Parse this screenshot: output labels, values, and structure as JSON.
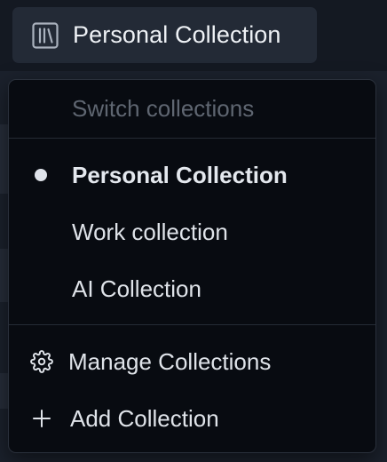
{
  "header_button": {
    "icon": "library-icon",
    "label": "Personal Collection"
  },
  "menu": {
    "header": "Switch collections",
    "collections": [
      {
        "label": "Personal Collection",
        "selected": true
      },
      {
        "label": "Work collection",
        "selected": false
      },
      {
        "label": "AI Collection",
        "selected": false
      }
    ],
    "actions": [
      {
        "icon": "gear-icon",
        "label": "Manage Collections"
      },
      {
        "icon": "plus-icon",
        "label": "Add Collection"
      }
    ]
  },
  "colors": {
    "menu_background": "#080b11",
    "button_background": "#232a36",
    "muted_text": "#5f6671",
    "text": "#dfe3e9"
  }
}
